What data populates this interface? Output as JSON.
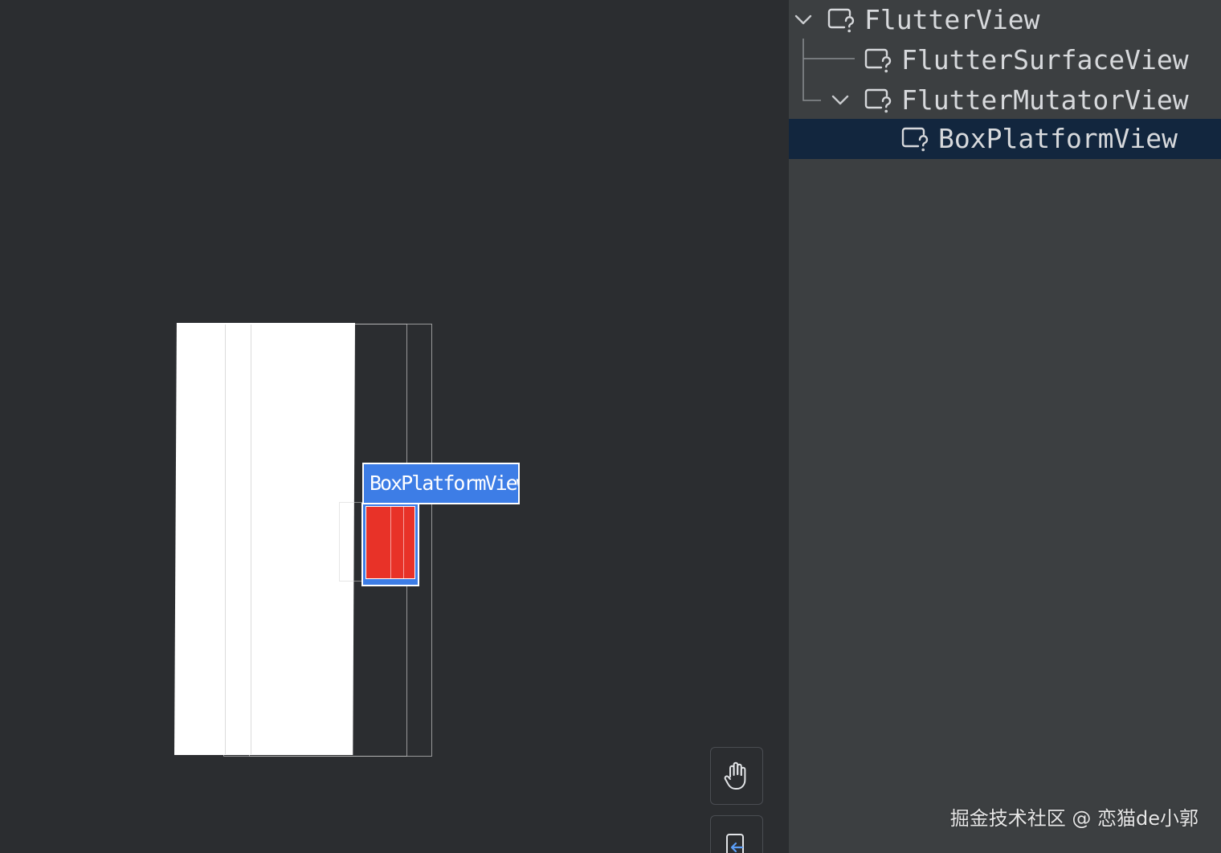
{
  "viewport": {
    "selected_label": "BoxPlatformView"
  },
  "toolbar": {
    "pan_icon": "hand-icon",
    "reset_icon": "reset-view-icon"
  },
  "tree": {
    "nodes": [
      {
        "label": "FlutterView",
        "expanded": true,
        "depth": 0
      },
      {
        "label": "FlutterSurfaceView",
        "expanded": false,
        "depth": 1
      },
      {
        "label": "FlutterMutatorView",
        "expanded": true,
        "depth": 1
      },
      {
        "label": "BoxPlatformView",
        "expanded": false,
        "depth": 2,
        "selected": true
      }
    ]
  },
  "watermark": "掘金技术社区 @ 恋猫de小郭",
  "colors": {
    "background": "#2b2d30",
    "panel": "#3c3f41",
    "selection": "#12263e",
    "highlight": "#3d7de6",
    "platform_view": "#e83228"
  }
}
